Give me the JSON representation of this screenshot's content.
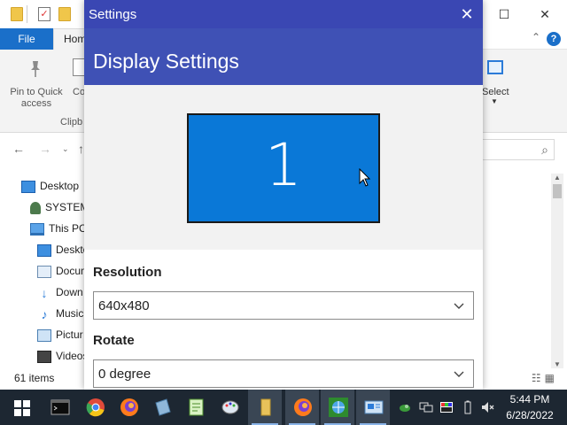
{
  "explorer": {
    "ribbon_tabs": {
      "file": "File",
      "home": "Home"
    },
    "ribbon": {
      "pin_label": "Pin to Quick access",
      "copy_label": "Co",
      "clipboard_group": "Clipb",
      "select_label": "Select"
    },
    "nav": {
      "items": [
        {
          "label": "Desktop",
          "icon": "desktop-icon"
        },
        {
          "label": "SYSTEM",
          "icon": "user-icon"
        },
        {
          "label": "This PC",
          "icon": "computer-icon"
        },
        {
          "label": "Deskto",
          "icon": "desktop-icon"
        },
        {
          "label": "Docum",
          "icon": "documents-icon"
        },
        {
          "label": "Down",
          "icon": "downloads-icon"
        },
        {
          "label": "Music",
          "icon": "music-icon"
        },
        {
          "label": "Pictur",
          "icon": "pictures-icon"
        },
        {
          "label": "Videos",
          "icon": "videos-icon"
        }
      ]
    },
    "status": {
      "item_count": "61 items"
    }
  },
  "dialog": {
    "title": "Settings",
    "heading": "Display Settings",
    "monitor_number": "1",
    "resolution": {
      "label": "Resolution",
      "value": "640x480"
    },
    "rotate": {
      "label": "Rotate",
      "value": "0 degree"
    }
  },
  "taskbar": {
    "clock": {
      "time": "5:44 PM",
      "date": "6/28/2022"
    }
  },
  "colors": {
    "dialog_title_bar": "#3a47b3",
    "dialog_header": "#3f51b5",
    "monitor_fill": "#0a78d7",
    "file_tab": "#1a6fc9",
    "taskbar": "#1d2732"
  }
}
